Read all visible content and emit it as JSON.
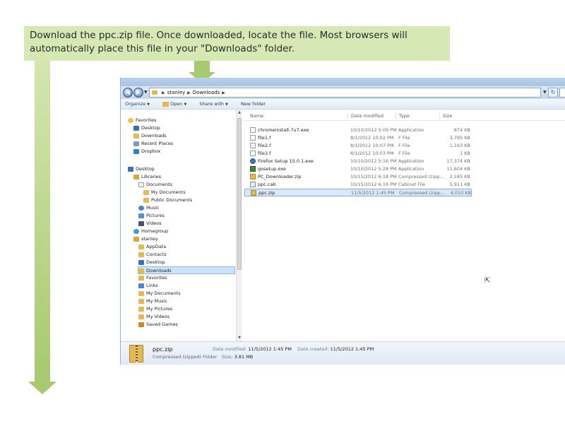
{
  "instruction": {
    "line1": "Download the ppc.zip file. Once downloaded, locate the file. Most browsers will",
    "line2": "automatically place this file in your \"Downloads\" folder."
  },
  "colors": {
    "banner": "#d6e8b4",
    "arrow": "#a7c96f",
    "selection": "#d9e9fb"
  },
  "address": {
    "crumb1": "stanley",
    "crumb2": "Downloads",
    "refresh_glyph": "↻"
  },
  "toolbar": {
    "organize": "Organize",
    "open": "Open",
    "share": "Share with",
    "new_folder": "New folder"
  },
  "nav": {
    "favorites": "Favorites",
    "desktop": "Desktop",
    "downloads": "Downloads",
    "recent": "Recent Places",
    "dropbox": "Dropbox",
    "desktop_root": "Desktop",
    "libraries": "Libraries",
    "documents": "Documents",
    "my_documents": "My Documents",
    "public_documents": "Public Documents",
    "music": "Music",
    "pictures": "Pictures",
    "videos": "Videos",
    "homegroup": "Homegroup",
    "stanley": "stanley",
    "appdata": "AppData",
    "contacts": "Contacts",
    "u_desktop": "Desktop",
    "u_downloads": "Downloads",
    "u_favorites": "Favorites",
    "u_links": "Links",
    "u_my_documents": "My Documents",
    "u_my_music": "My Music",
    "u_my_pictures": "My Pictures",
    "u_my_videos": "My Videos",
    "u_saved_games": "Saved Games"
  },
  "columns": {
    "name": "Name",
    "date": "Date modified",
    "type": "Type",
    "size": "Size"
  },
  "files": [
    {
      "name": "chromeinstall-7u7.exe",
      "date": "10/10/2012 5:09 PM",
      "type": "Application",
      "size": "874 KB"
    },
    {
      "name": "file1.f",
      "date": "8/1/2012 10:02 PM",
      "type": "F File",
      "size": "3,795 KB"
    },
    {
      "name": "file2.f",
      "date": "8/1/2012 10:07 PM",
      "type": "F File",
      "size": "1,193 KB"
    },
    {
      "name": "file3.f",
      "date": "8/1/2012 10:03 PM",
      "type": "F File",
      "size": "1 KB"
    },
    {
      "name": "Firefox Setup 15.0.1.exe",
      "date": "10/10/2012 5:16 PM",
      "type": "Application",
      "size": "17,374 KB"
    },
    {
      "name": "gosetup.exe",
      "date": "10/10/2012 5:28 PM",
      "type": "Application",
      "size": "11,604 KB"
    },
    {
      "name": "PC_Downloader.zip",
      "date": "10/15/2012 6:18 PM",
      "type": "Compressed (zipp...",
      "size": "2,185 KB"
    },
    {
      "name": "ppc.cab",
      "date": "10/15/2012 6:16 PM",
      "type": "Cabinet File",
      "size": "5,911 KB"
    },
    {
      "name": "ppc.zip",
      "date": "11/5/2012 1:45 PM",
      "type": "Compressed (zipp...",
      "size": "4,010 KB"
    }
  ],
  "details": {
    "name": "ppc.zip",
    "type": "Compressed (zipped) Folder",
    "modified_label": "Date modified:",
    "modified": "11/5/2012 1:45 PM",
    "size_label": "Size:",
    "size": "3.81 MB",
    "created_label": "Date created:",
    "created": "11/5/2012 1:45 PM"
  }
}
